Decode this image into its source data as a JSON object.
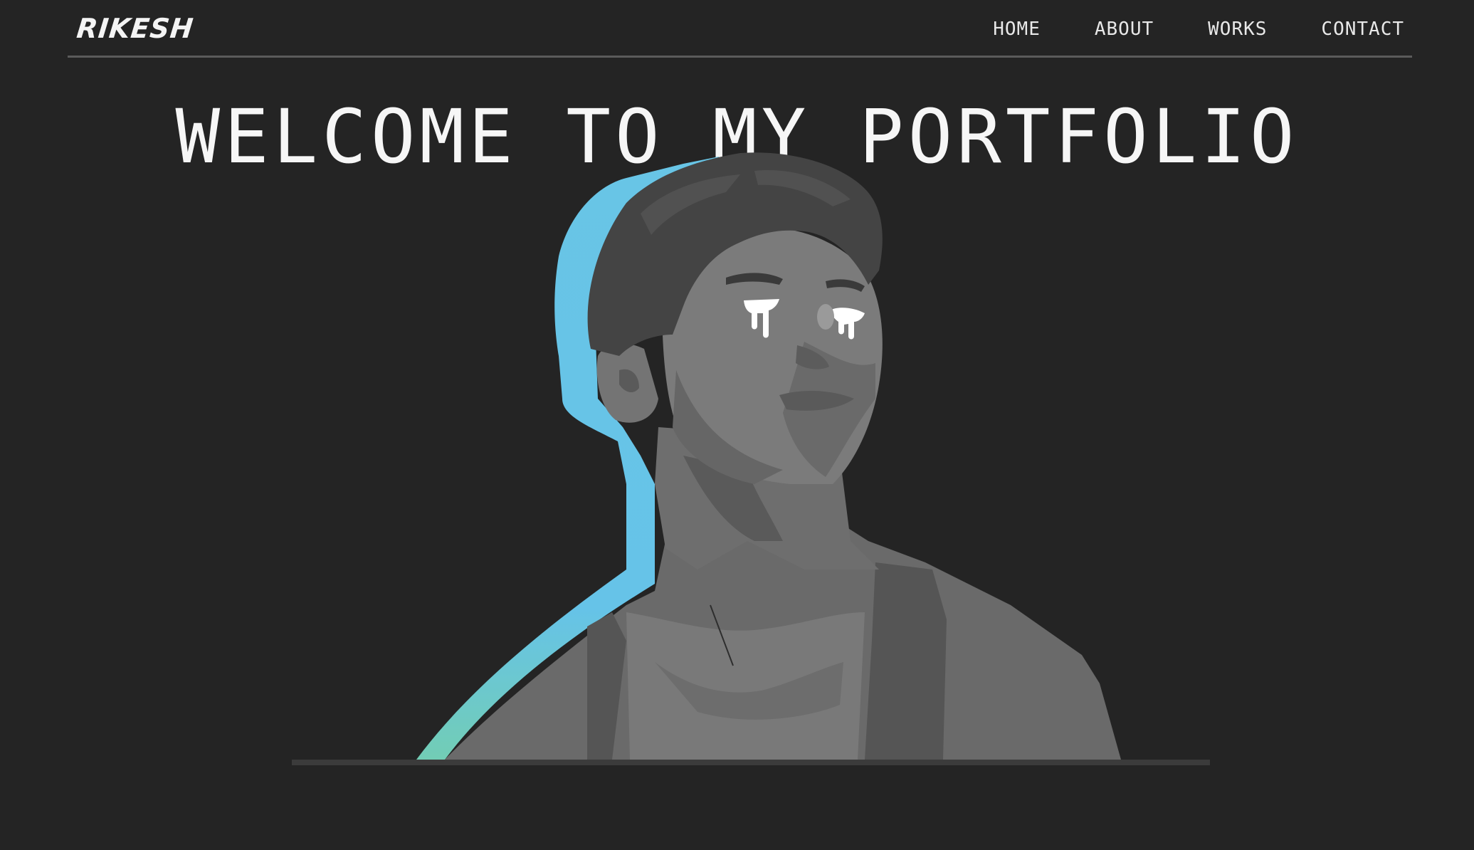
{
  "header": {
    "logo_text": "RIKESH",
    "nav": [
      {
        "label": "HOME"
      },
      {
        "label": "ABOUT"
      },
      {
        "label": "WORKS"
      },
      {
        "label": "CONTACT"
      }
    ]
  },
  "hero": {
    "title": "WELCOME TO MY PORTFOLIO",
    "image": "portrait-illustration"
  },
  "colors": {
    "background": "#242424",
    "text": "#f2f2f2",
    "accent_cyan": "#68c5e6",
    "accent_teal": "#6fcdb8",
    "divider": "#5b5b5b"
  }
}
